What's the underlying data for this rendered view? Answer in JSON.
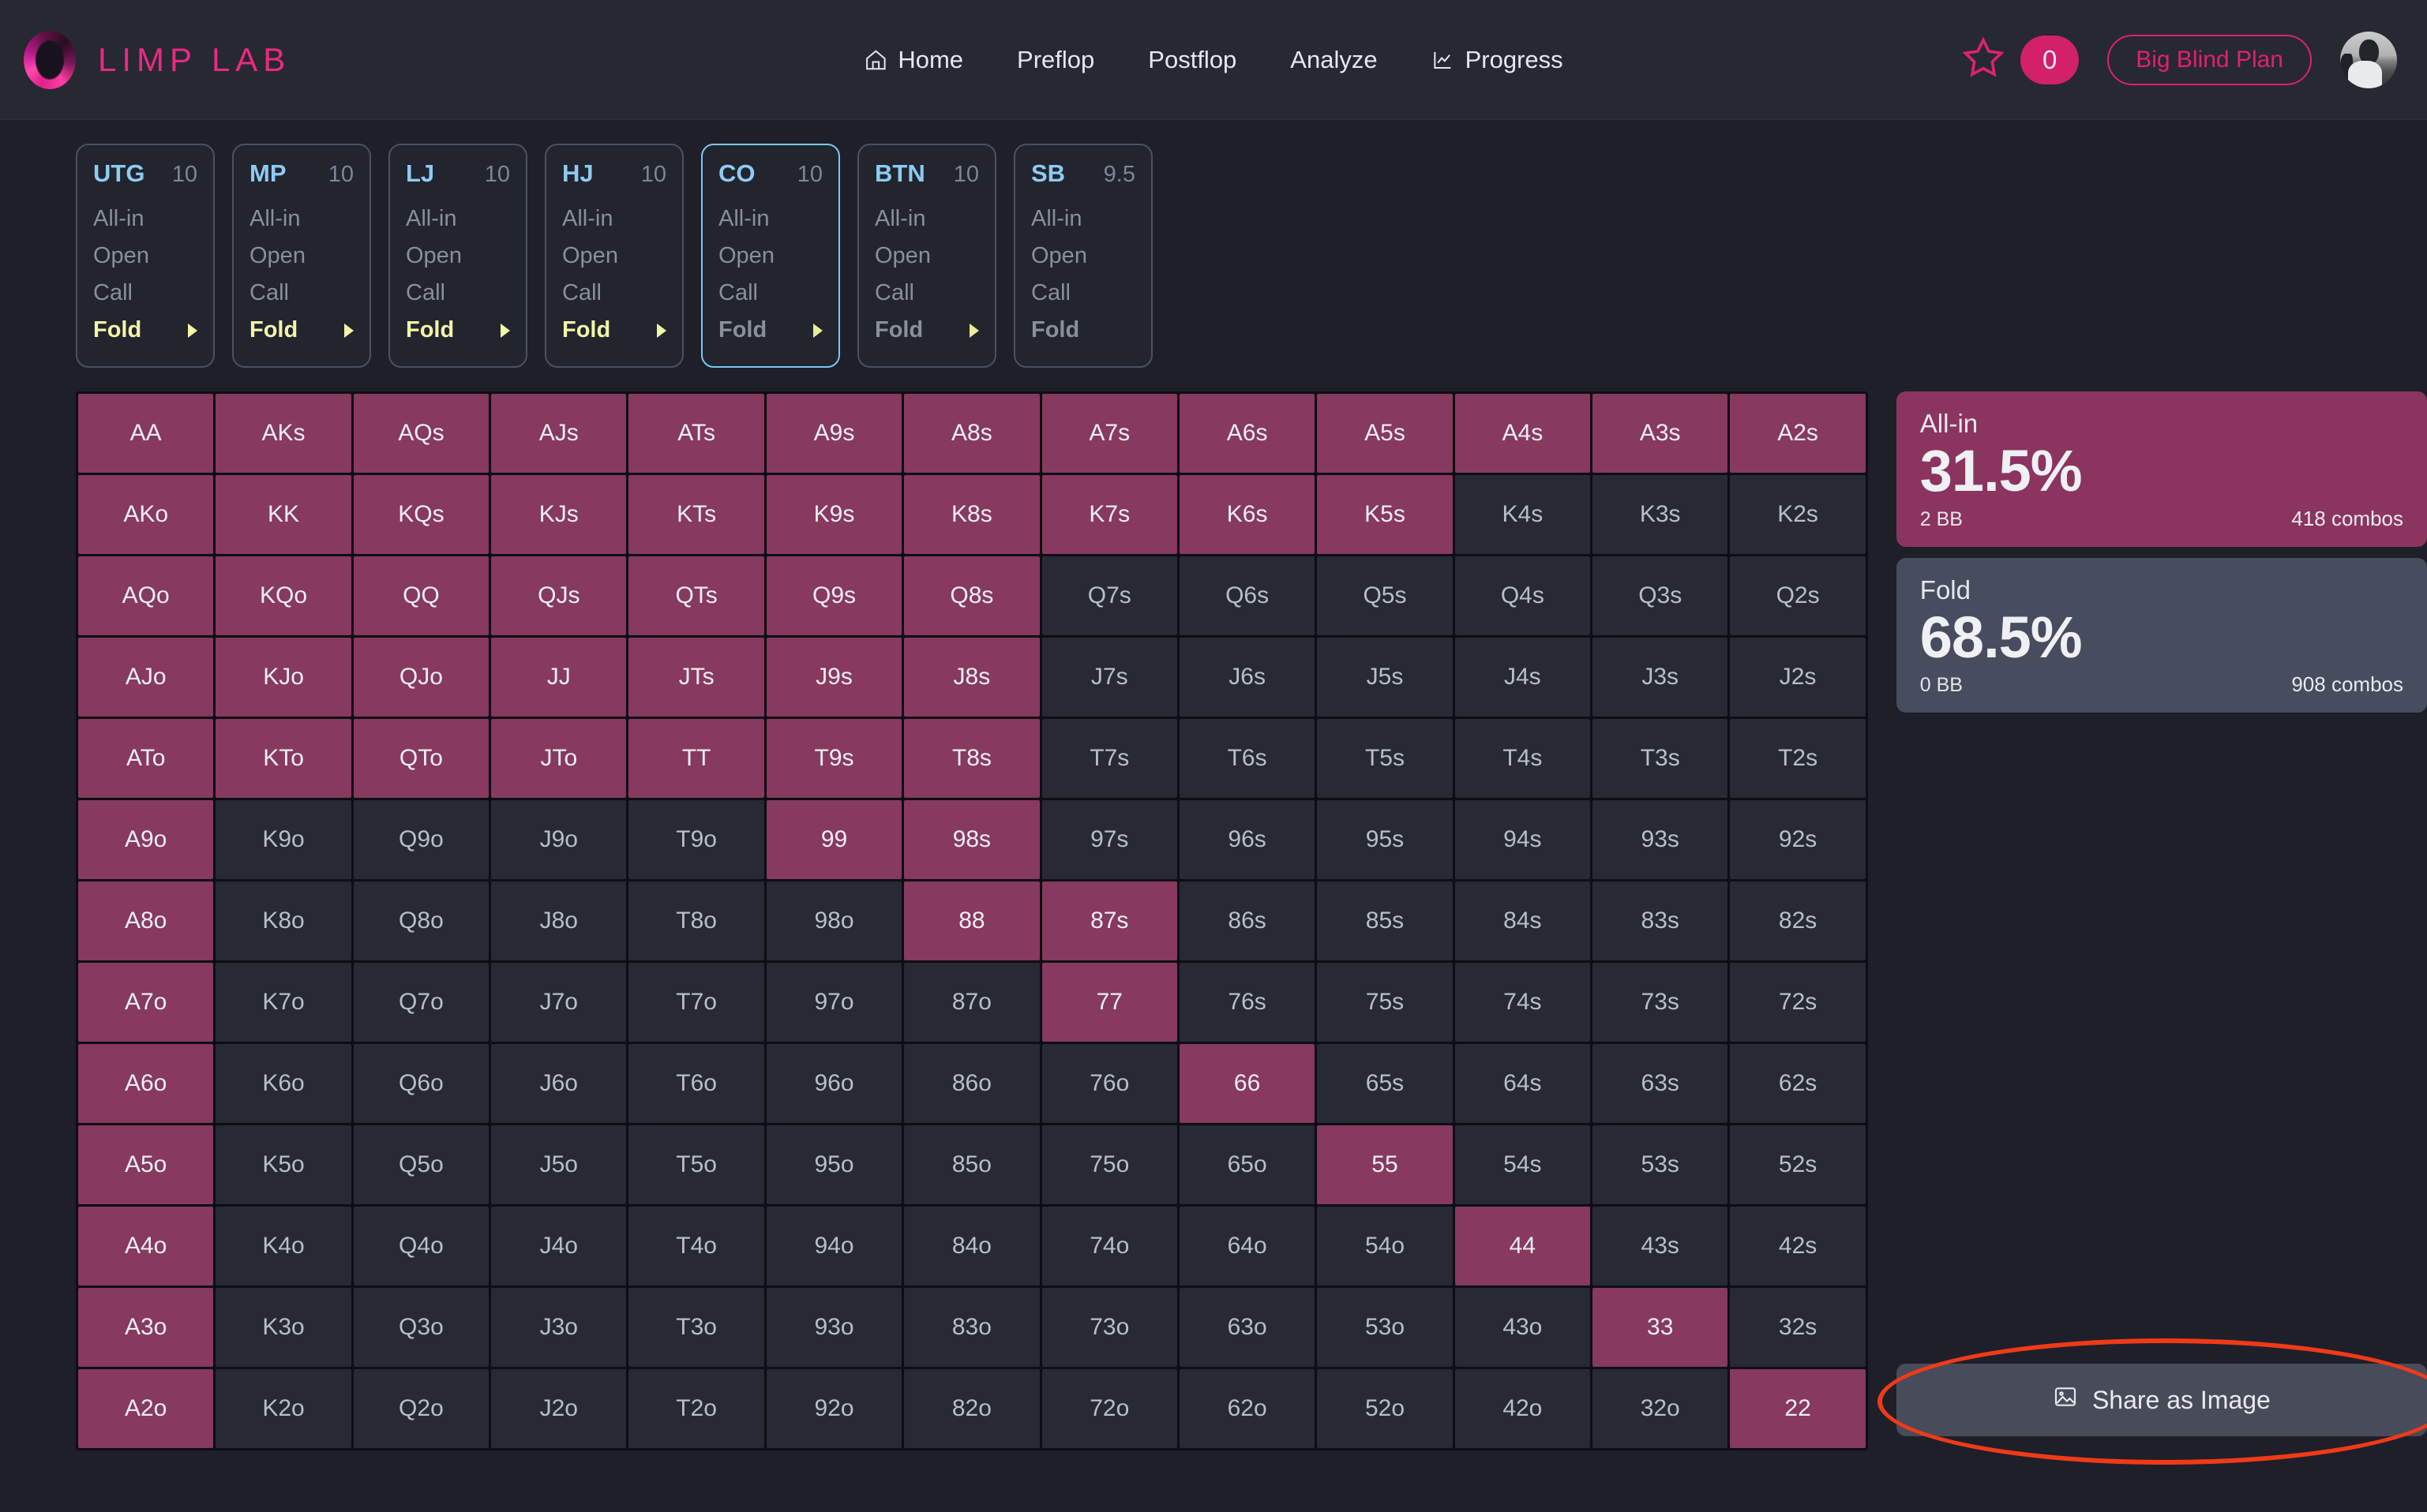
{
  "brand": {
    "name": "LIMP LAB"
  },
  "nav": {
    "items": [
      {
        "label": "Home",
        "icon": "home-icon"
      },
      {
        "label": "Preflop",
        "icon": ""
      },
      {
        "label": "Postflop",
        "icon": ""
      },
      {
        "label": "Analyze",
        "icon": ""
      },
      {
        "label": "Progress",
        "icon": "chart-line-icon"
      }
    ]
  },
  "header_right": {
    "star_icon": "star-outline-icon",
    "badge_count": "0",
    "plan_label": "Big Blind Plan",
    "avatar": "user-avatar"
  },
  "colors": {
    "brand_pink": "#ea2a80",
    "accent_blue": "#8ecbf2",
    "fold_yellow": "#f2f5a8",
    "range_on": "#87395f",
    "range_off": "#272a35",
    "annotation_red": "#f03a17"
  },
  "positions": [
    {
      "name": "UTG",
      "stack": "10",
      "options": [
        "All-in",
        "Open",
        "Call"
      ],
      "last_option": "Fold",
      "has_arrow": true,
      "fold_highlight": true,
      "active": false
    },
    {
      "name": "MP",
      "stack": "10",
      "options": [
        "All-in",
        "Open",
        "Call"
      ],
      "last_option": "Fold",
      "has_arrow": true,
      "fold_highlight": true,
      "active": false
    },
    {
      "name": "LJ",
      "stack": "10",
      "options": [
        "All-in",
        "Open",
        "Call"
      ],
      "last_option": "Fold",
      "has_arrow": true,
      "fold_highlight": true,
      "active": false
    },
    {
      "name": "HJ",
      "stack": "10",
      "options": [
        "All-in",
        "Open",
        "Call"
      ],
      "last_option": "Fold",
      "has_arrow": true,
      "fold_highlight": true,
      "active": false
    },
    {
      "name": "CO",
      "stack": "10",
      "options": [
        "All-in",
        "Open",
        "Call"
      ],
      "last_option": "Fold",
      "has_arrow": true,
      "fold_highlight": false,
      "active": true
    },
    {
      "name": "BTN",
      "stack": "10",
      "options": [
        "All-in",
        "Open",
        "Call"
      ],
      "last_option": "Fold",
      "has_arrow": true,
      "fold_highlight": false,
      "active": false
    },
    {
      "name": "SB",
      "stack": "9.5",
      "options": [
        "All-in",
        "Open",
        "Call"
      ],
      "last_option": "Fold",
      "has_arrow": false,
      "fold_highlight": false,
      "active": false
    }
  ],
  "range_grid": {
    "rows": [
      [
        "AA",
        "AKs",
        "AQs",
        "AJs",
        "ATs",
        "A9s",
        "A8s",
        "A7s",
        "A6s",
        "A5s",
        "A4s",
        "A3s",
        "A2s"
      ],
      [
        "AKo",
        "KK",
        "KQs",
        "KJs",
        "KTs",
        "K9s",
        "K8s",
        "K7s",
        "K6s",
        "K5s",
        "K4s",
        "K3s",
        "K2s"
      ],
      [
        "AQo",
        "KQo",
        "QQ",
        "QJs",
        "QTs",
        "Q9s",
        "Q8s",
        "Q7s",
        "Q6s",
        "Q5s",
        "Q4s",
        "Q3s",
        "Q2s"
      ],
      [
        "AJo",
        "KJo",
        "QJo",
        "JJ",
        "JTs",
        "J9s",
        "J8s",
        "J7s",
        "J6s",
        "J5s",
        "J4s",
        "J3s",
        "J2s"
      ],
      [
        "ATo",
        "KTo",
        "QTo",
        "JTo",
        "TT",
        "T9s",
        "T8s",
        "T7s",
        "T6s",
        "T5s",
        "T4s",
        "T3s",
        "T2s"
      ],
      [
        "A9o",
        "K9o",
        "Q9o",
        "J9o",
        "T9o",
        "99",
        "98s",
        "97s",
        "96s",
        "95s",
        "94s",
        "93s",
        "92s"
      ],
      [
        "A8o",
        "K8o",
        "Q8o",
        "J8o",
        "T8o",
        "98o",
        "88",
        "87s",
        "86s",
        "85s",
        "84s",
        "83s",
        "82s"
      ],
      [
        "A7o",
        "K7o",
        "Q7o",
        "J7o",
        "T7o",
        "97o",
        "87o",
        "77",
        "76s",
        "75s",
        "74s",
        "73s",
        "72s"
      ],
      [
        "A6o",
        "K6o",
        "Q6o",
        "J6o",
        "T6o",
        "96o",
        "86o",
        "76o",
        "66",
        "65s",
        "64s",
        "63s",
        "62s"
      ],
      [
        "A5o",
        "K5o",
        "Q5o",
        "J5o",
        "T5o",
        "95o",
        "85o",
        "75o",
        "65o",
        "55",
        "54s",
        "53s",
        "52s"
      ],
      [
        "A4o",
        "K4o",
        "Q4o",
        "J4o",
        "T4o",
        "94o",
        "84o",
        "74o",
        "64o",
        "54o",
        "44",
        "43s",
        "42s"
      ],
      [
        "A3o",
        "K3o",
        "Q3o",
        "J3o",
        "T3o",
        "93o",
        "83o",
        "73o",
        "63o",
        "53o",
        "43o",
        "33",
        "32s"
      ],
      [
        "A2o",
        "K2o",
        "Q2o",
        "J2o",
        "T2o",
        "92o",
        "82o",
        "72o",
        "62o",
        "52o",
        "42o",
        "32o",
        "22"
      ]
    ],
    "selected": [
      [
        1,
        1,
        1,
        1,
        1,
        1,
        1,
        1,
        1,
        1,
        1,
        1,
        1
      ],
      [
        1,
        1,
        1,
        1,
        1,
        1,
        1,
        1,
        1,
        1,
        0,
        0,
        0
      ],
      [
        1,
        1,
        1,
        1,
        1,
        1,
        1,
        0,
        0,
        0,
        0,
        0,
        0
      ],
      [
        1,
        1,
        1,
        1,
        1,
        1,
        1,
        0,
        0,
        0,
        0,
        0,
        0
      ],
      [
        1,
        1,
        1,
        1,
        1,
        1,
        1,
        0,
        0,
        0,
        0,
        0,
        0
      ],
      [
        1,
        0,
        0,
        0,
        0,
        1,
        1,
        0,
        0,
        0,
        0,
        0,
        0
      ],
      [
        1,
        0,
        0,
        0,
        0,
        0,
        1,
        1,
        0,
        0,
        0,
        0,
        0
      ],
      [
        1,
        0,
        0,
        0,
        0,
        0,
        0,
        1,
        0,
        0,
        0,
        0,
        0
      ],
      [
        1,
        0,
        0,
        0,
        0,
        0,
        0,
        0,
        1,
        0,
        0,
        0,
        0
      ],
      [
        1,
        0,
        0,
        0,
        0,
        0,
        0,
        0,
        0,
        1,
        0,
        0,
        0
      ],
      [
        1,
        0,
        0,
        0,
        0,
        0,
        0,
        0,
        0,
        0,
        1,
        0,
        0
      ],
      [
        1,
        0,
        0,
        0,
        0,
        0,
        0,
        0,
        0,
        0,
        0,
        1,
        0
      ],
      [
        1,
        0,
        0,
        0,
        0,
        0,
        0,
        0,
        0,
        0,
        0,
        0,
        1
      ]
    ]
  },
  "stats": [
    {
      "label": "All-in",
      "value": "31.5%",
      "bb": "2 BB",
      "combos": "418 combos"
    },
    {
      "label": "Fold",
      "value": "68.5%",
      "bb": "0 BB",
      "combos": "908 combos"
    }
  ],
  "share": {
    "label": "Share as Image",
    "icon": "image-icon"
  }
}
